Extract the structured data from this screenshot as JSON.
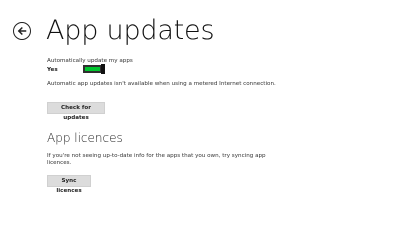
{
  "header": {
    "title": "App updates",
    "back_icon": "back-arrow-icon"
  },
  "auto_update": {
    "label": "Automatically update my apps",
    "state_text": "Yes",
    "toggle_on": true,
    "accent_color": "#00c62e",
    "info": "Automatic app updates isn't available when using a metered Internet connection.",
    "button_label": "Check for updates"
  },
  "licences": {
    "title": "App licences",
    "description": "If you're not seeing up-to-date info for the apps that you own, try syncing app licences.",
    "button_label": "Sync licences"
  }
}
